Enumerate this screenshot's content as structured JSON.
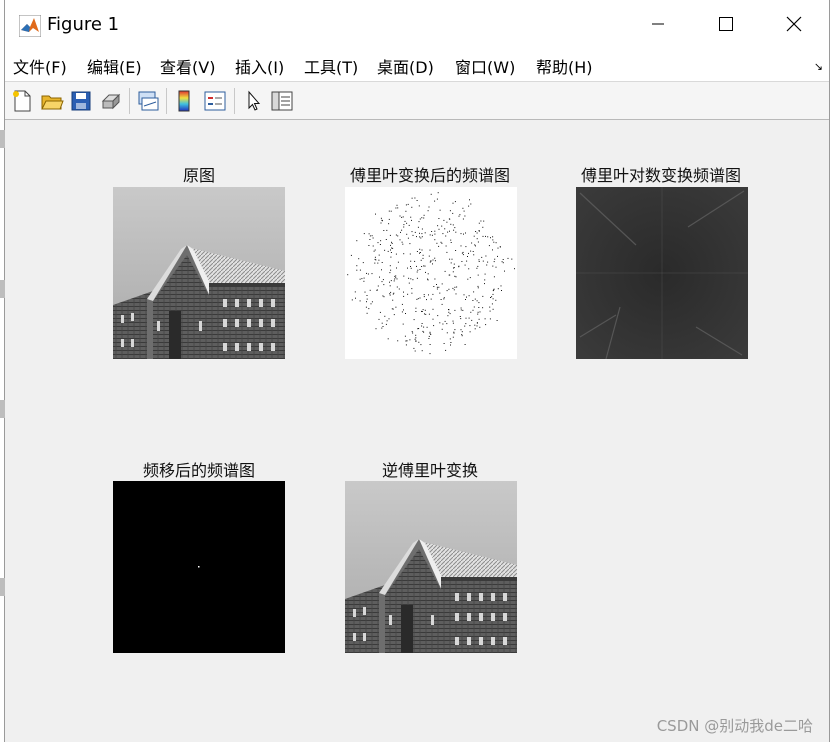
{
  "window": {
    "title": "Figure 1",
    "controls": {
      "minimize": "minimize",
      "maximize": "maximize",
      "close": "close"
    }
  },
  "menu": {
    "items": [
      "文件(F)",
      "编辑(E)",
      "查看(V)",
      "插入(I)",
      "工具(T)",
      "桌面(D)",
      "窗口(W)",
      "帮助(H)"
    ]
  },
  "toolbar": {
    "icons": [
      "new-figure-icon",
      "open-file-icon",
      "save-icon",
      "print-icon",
      "link-plot-icon",
      "colorbar-icon",
      "legend-icon",
      "edit-plot-arrow-icon",
      "property-inspector-icon"
    ]
  },
  "subplots": [
    {
      "title": "原图",
      "image": "original building photo (grayscale)"
    },
    {
      "title": "傅里叶变换后的频谱图",
      "image": "sparse scatter of dark points on white"
    },
    {
      "title": "傅里叶对数变换频谱图",
      "image": "dark gray log spectrum"
    },
    {
      "title": "频移后的频谱图",
      "image": "black with single bright center point"
    },
    {
      "title": "逆傅里叶变换",
      "image": "reconstructed building photo (grayscale)"
    }
  ],
  "watermark": "CSDN @别动我de二哈"
}
